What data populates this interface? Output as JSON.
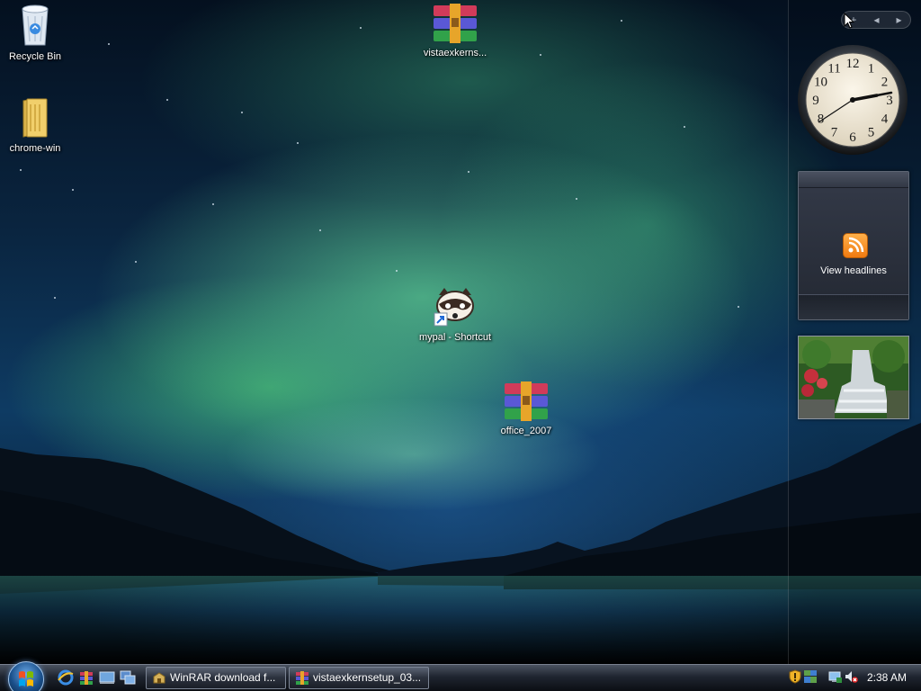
{
  "desktop": {
    "icons": [
      {
        "label": "Recycle Bin",
        "icon": "recycle-bin-icon"
      },
      {
        "label": "chrome-win",
        "icon": "folder-icon"
      },
      {
        "label": "vistaexkerns...",
        "icon": "winrar-archive-icon"
      },
      {
        "label": "mypal - Shortcut",
        "icon": "raccoon-shortcut-icon"
      },
      {
        "label": "office_2007",
        "icon": "winrar-archive-icon"
      }
    ]
  },
  "sidebar": {
    "toolbar": {
      "add_label": "+",
      "prev_label": "◂",
      "next_label": "▸"
    },
    "clock": {
      "numbers": [
        "12",
        "1",
        "2",
        "3",
        "4",
        "5",
        "6",
        "7",
        "8",
        "9",
        "10",
        "11"
      ],
      "time": "2:38"
    },
    "feed": {
      "label": "View headlines",
      "icon": "rss-icon"
    },
    "slideshow": {
      "icon": "waterfall-photo"
    }
  },
  "taskbar": {
    "quick_launch": [
      "internet-explorer-icon",
      "winrar-icon",
      "show-desktop-icon",
      "switch-windows-icon"
    ],
    "tasks": [
      {
        "label": "WinRAR download f...",
        "icon": "winrar-icon"
      },
      {
        "label": "vistaexkernsetup_03...",
        "icon": "winrar-archive-icon"
      }
    ],
    "tray": {
      "icons": [
        "security-shield-icon",
        "network-icon",
        "safely-remove-icon",
        "volume-muted-icon"
      ],
      "time": "2:38 AM"
    }
  },
  "colors": {
    "accent": "#1a4f8a",
    "aurora": "#55be8c",
    "rss": "#f07a10"
  }
}
